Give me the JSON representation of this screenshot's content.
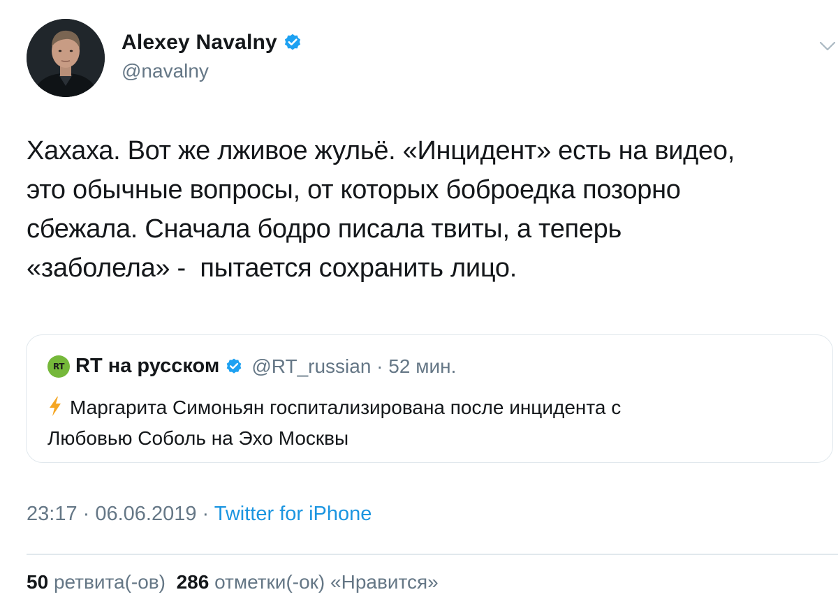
{
  "author": {
    "name": "Alexey Navalny",
    "handle": "@navalny",
    "verified": true
  },
  "tweet": {
    "lines": [
      "Хахаха. Вот же лживое жульё. «Инцидент» есть на видео,",
      "это обычные вопросы, от которых боброедка позорно",
      "сбежала. Сначала бодро писала твиты, а теперь",
      "«заболела» -  пытается сохранить лицо."
    ]
  },
  "quote": {
    "logo_text": "RT",
    "name": "RT на русском",
    "handle_time": "@RT_russian · 52 мин.",
    "lines": [
      "Маргарита Симоньян госпитализирована после инцидента с",
      "Любовью Соболь на Эхо Москвы"
    ]
  },
  "meta": {
    "time_date": "23:17 · 06.06.2019 · ",
    "source": "Twitter for iPhone"
  },
  "stats": {
    "retweets_count": "50",
    "retweets_label": "ретвита(-ов)",
    "likes_count": "286",
    "likes_label": "отметки(-ок) «Нравится»"
  },
  "colors": {
    "verified": "#1da1f2",
    "rt_green": "#75b83a",
    "bolt": "#f5a623",
    "muted": "#657786",
    "link": "#1b95e0"
  },
  "icons": [
    "avatar",
    "verified-icon",
    "chevron-down-icon",
    "rt-logo-icon",
    "lightning-icon"
  ]
}
